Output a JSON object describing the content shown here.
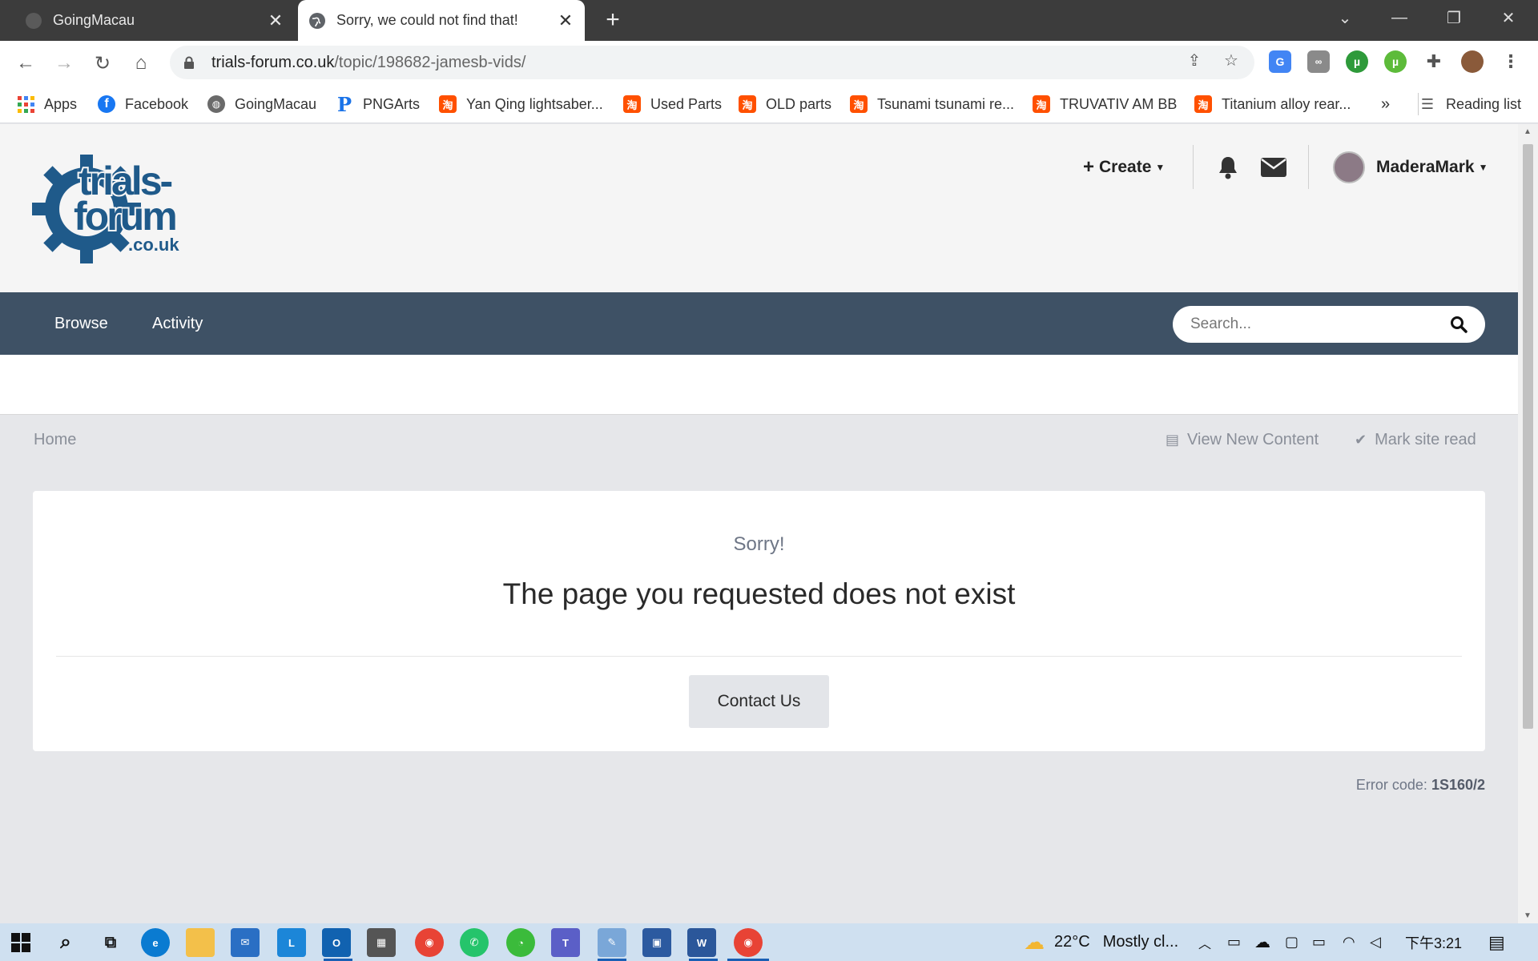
{
  "browser": {
    "tabs": [
      {
        "title": "GoingMacau",
        "active": false
      },
      {
        "title": "Sorry, we could not find that!",
        "active": true
      }
    ],
    "url_host": "trials-forum.co.uk",
    "url_path": "/topic/198682-jamesb-vids/",
    "bookmarks": [
      {
        "label": "Apps",
        "icon": "apps-grid-icon"
      },
      {
        "label": "Facebook",
        "icon": "facebook-icon"
      },
      {
        "label": "GoingMacau",
        "icon": "globe-icon"
      },
      {
        "label": "PNGArts",
        "icon": "pngarts-icon"
      },
      {
        "label": "Yan Qing lightsaber...",
        "icon": "taobao-icon"
      },
      {
        "label": "Used Parts",
        "icon": "taobao-icon"
      },
      {
        "label": "OLD parts",
        "icon": "taobao-icon"
      },
      {
        "label": "Tsunami tsunami re...",
        "icon": "taobao-icon"
      },
      {
        "label": "TRUVATIV AM BB",
        "icon": "taobao-icon"
      },
      {
        "label": "Titanium alloy rear...",
        "icon": "taobao-icon"
      }
    ],
    "bookmarks_overflow": "»",
    "reading_list": "Reading list",
    "taobao_glyph": "淘"
  },
  "site": {
    "logo_text_1": "trials-",
    "logo_text_2": "forum",
    "logo_text_3": ".co.uk",
    "create_label": "Create",
    "username": "MaderaMark",
    "nav": [
      "Browse",
      "Activity"
    ],
    "search_placeholder": "Search...",
    "breadcrumb_home": "Home",
    "view_new_content": "View New Content",
    "mark_site_read": "Mark site read"
  },
  "error": {
    "sorry": "Sorry!",
    "message": "The page you requested does not exist",
    "contact_label": "Contact Us",
    "code_label": "Error code:",
    "code_value": "1S160/2"
  },
  "taskbar": {
    "weather_temp": "22°C",
    "weather_text": "Mostly cl...",
    "time": "下午3:21"
  },
  "colors": {
    "navbar": "#3e5165",
    "logo_blue": "#1f5a8a",
    "taskbar": "#cfe0f0"
  }
}
